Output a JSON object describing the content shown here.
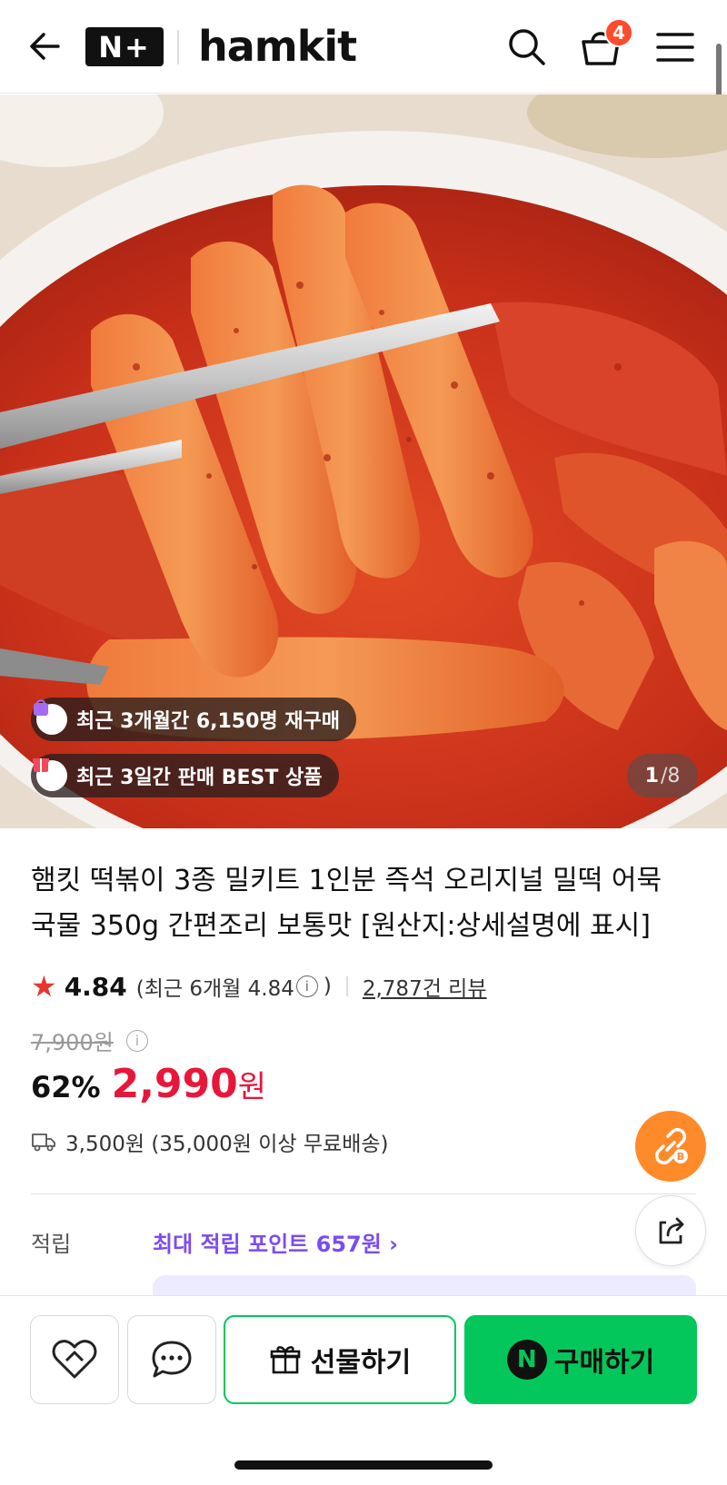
{
  "header": {
    "nplus_label": "N+",
    "brand": "hamkit",
    "cart_count": "4"
  },
  "hero": {
    "badges": [
      {
        "text": "최근 3개월간 6,150명 재구매"
      },
      {
        "text": "최근 3일간 판매 BEST 상품"
      }
    ],
    "counter_current": "1",
    "counter_total": "8",
    "icons": [
      "back-arrow-icon",
      "search-icon",
      "cart-icon",
      "menu-icon",
      "bag-icon",
      "gift-box-icon"
    ]
  },
  "product": {
    "title_line1": "햄킷 떡볶이 3종 밀키트 1인분 즉석 오리지널 밀떡 어묵",
    "title_line2": "국물 350g 간편조리 보통맛 [원산지:상세설명에 표시]",
    "rating": "4.84",
    "rating_recent": "(최근 6개월 4.84",
    "rating_close": ")",
    "reviews": "2,787건 리뷰",
    "original_price": "7,900원",
    "discount": "62%",
    "price": "2,990",
    "currency": "원",
    "shipping": "3,500원 (35,000원 이상 무료배송)",
    "points_label": "적립",
    "points_text": "최대 적립 포인트 657원"
  },
  "actions": {
    "gift_label": "선물하기",
    "buy_label": "구매하기",
    "buy_badge": "N"
  },
  "colors": {
    "accent_green": "#03c75a",
    "price_red": "#e8163a",
    "points_purple": "#7b4cf2",
    "badge_orange": "#ff4a2b",
    "fab_orange": "#ff8a2a"
  }
}
